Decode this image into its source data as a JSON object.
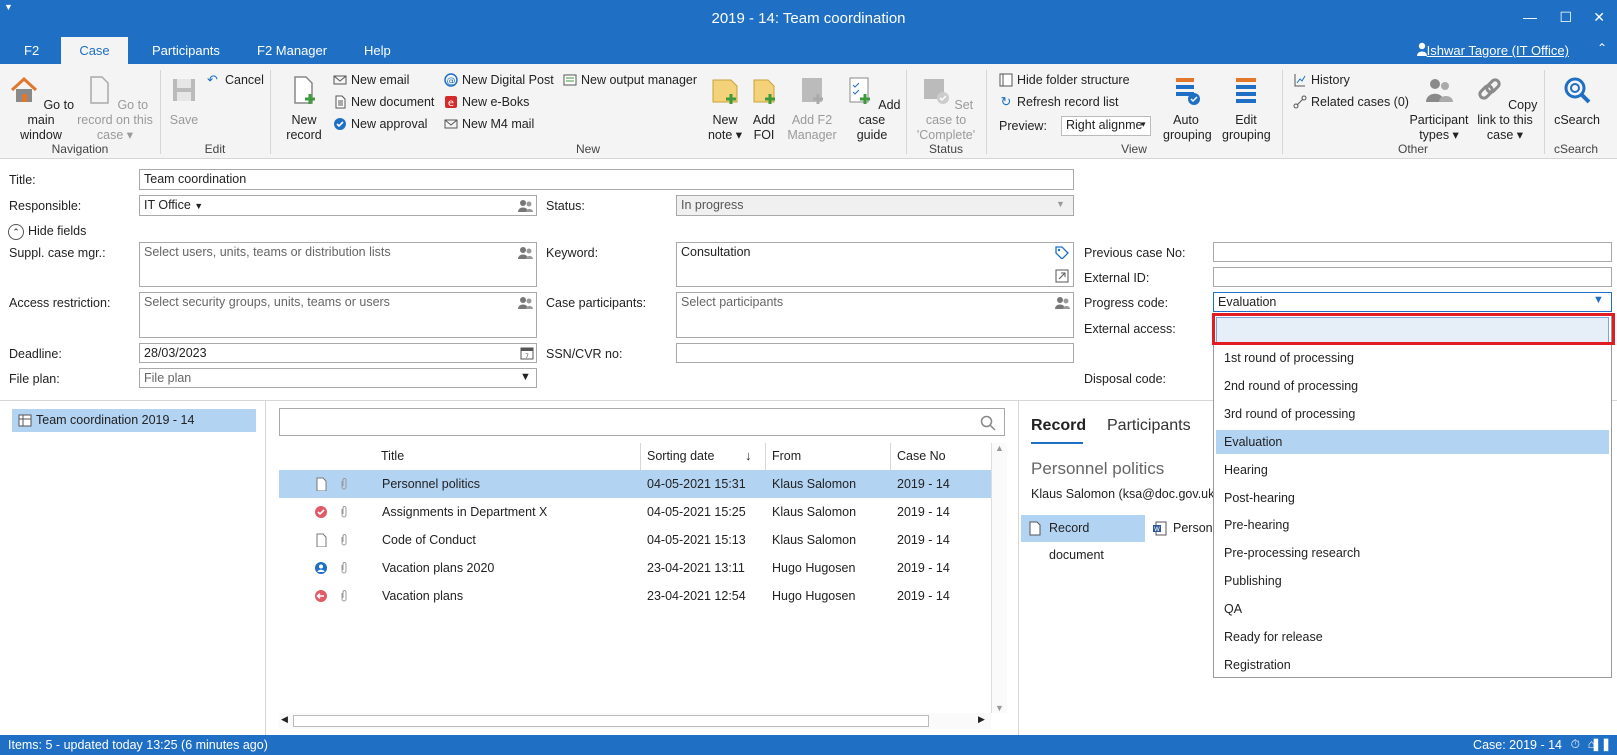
{
  "window": {
    "title": "2019 - 14: Team coordination",
    "minimize": "—",
    "maximize": "☐",
    "close": "✕"
  },
  "tabs": [
    {
      "label": "F2"
    },
    {
      "label": "Case",
      "active": true
    },
    {
      "label": "Participants"
    },
    {
      "label": "F2 Manager"
    },
    {
      "label": "Help"
    }
  ],
  "user": {
    "name": "Ishwar Tagore (IT Office)"
  },
  "ribbon": {
    "navigation": {
      "group": "Navigation",
      "go_main": "Go to main window",
      "go_record": "Go to record on this case ▾"
    },
    "edit": {
      "group": "Edit",
      "save": "Save",
      "cancel": "Cancel"
    },
    "new": {
      "group": "New",
      "new_record": "New record",
      "new_email": "New email",
      "new_document": "New document",
      "new_approval": "New approval",
      "new_digital_post": "New Digital Post",
      "new_eboks": "New e-Boks",
      "new_m4_mail": "New M4 mail",
      "new_output_manager": "New output manager",
      "new_note": "New note ▾",
      "add_foi": "Add FOI",
      "add_f2_manager": "Add F2 Manager",
      "add_case_guide": "Add case guide"
    },
    "status": {
      "group": "Status",
      "set_complete": "Set case to 'Complete'"
    },
    "view": {
      "group": "View",
      "hide_folder": "Hide folder structure",
      "refresh": "Refresh record list",
      "preview_label": "Preview:",
      "preview_value": "Right alignme",
      "auto_grouping": "Auto grouping",
      "edit_grouping": "Edit grouping"
    },
    "other": {
      "group": "Other",
      "history": "History",
      "related_cases": "Related cases (0)",
      "participant_types": "Participant types ▾",
      "copy_link": "Copy link to this case ▾"
    },
    "csearch": {
      "group": "cSearch",
      "label": "cSearch"
    }
  },
  "form": {
    "title_label": "Title:",
    "title_value": "Team coordination",
    "responsible_label": "Responsible:",
    "responsible_value": "IT Office",
    "status_label": "Status:",
    "status_value": "In progress",
    "hide_fields": "Hide fields",
    "suppl_label": "Suppl. case mgr.:",
    "suppl_placeholder": "Select users, units, teams or distribution lists",
    "keyword_label": "Keyword:",
    "keyword_value": "Consultation",
    "prev_case_label": "Previous case No:",
    "external_id_label": "External ID:",
    "access_label": "Access restriction:",
    "access_placeholder": "Select security groups, units, teams or users",
    "case_participants_label": "Case participants:",
    "case_participants_placeholder": "Select participants",
    "progress_label": "Progress code:",
    "progress_value": "Evaluation",
    "external_access_label": "External access:",
    "deadline_label": "Deadline:",
    "deadline_value": "28/03/2023",
    "ssn_label": "SSN/CVR no:",
    "file_plan_label": "File plan:",
    "file_plan_placeholder": "File plan",
    "disposal_label": "Disposal code:"
  },
  "tree": {
    "node": "Team coordination 2019 - 14"
  },
  "list": {
    "columns": [
      "Title",
      "Sorting date",
      "From",
      "Case No"
    ],
    "rows": [
      {
        "title": "Personnel politics",
        "date": "04-05-2021 15:31",
        "from": "Klaus Salomon",
        "case": "2019 - 14",
        "icon": "document-icon"
      },
      {
        "title": "Assignments in Department X",
        "date": "04-05-2021 15:25",
        "from": "Klaus Salomon",
        "case": "2019 - 14",
        "icon": "approved-icon"
      },
      {
        "title": "Code of Conduct",
        "date": "04-05-2021 15:13",
        "from": "Klaus Salomon",
        "case": "2019 - 14",
        "icon": "document-icon"
      },
      {
        "title": "Vacation plans 2020",
        "date": "23-04-2021 13:11",
        "from": "Hugo Hugosen",
        "case": "2019 - 14",
        "icon": "participant-icon"
      },
      {
        "title": "Vacation plans",
        "date": "23-04-2021 12:54",
        "from": "Hugo Hugosen",
        "case": "2019 - 14",
        "icon": "reply-icon"
      }
    ]
  },
  "preview": {
    "tab_record": "Record",
    "tab_participants": "Participants",
    "title": "Personnel politics",
    "sender": "Klaus Salomon (ksa@doc.gov.uk)",
    "record_document": "Record document",
    "attachment": "Person"
  },
  "dropdown": {
    "items": [
      "1st round of processing",
      "2nd round of processing",
      "3rd round of processing",
      "Evaluation",
      "Hearing",
      "Post-hearing",
      "Pre-hearing",
      "Pre-processing research",
      "Publishing",
      "QA",
      "Ready for release",
      "Registration"
    ],
    "selected": "Evaluation"
  },
  "statusbar": {
    "left": "Items: 5 - updated today 13:25 (6 minutes ago)",
    "right": "Case: 2019 - 14"
  },
  "colors": {
    "accent": "#1f6fc5",
    "selection": "#b3d3f2",
    "highlight": "#e31b23"
  }
}
